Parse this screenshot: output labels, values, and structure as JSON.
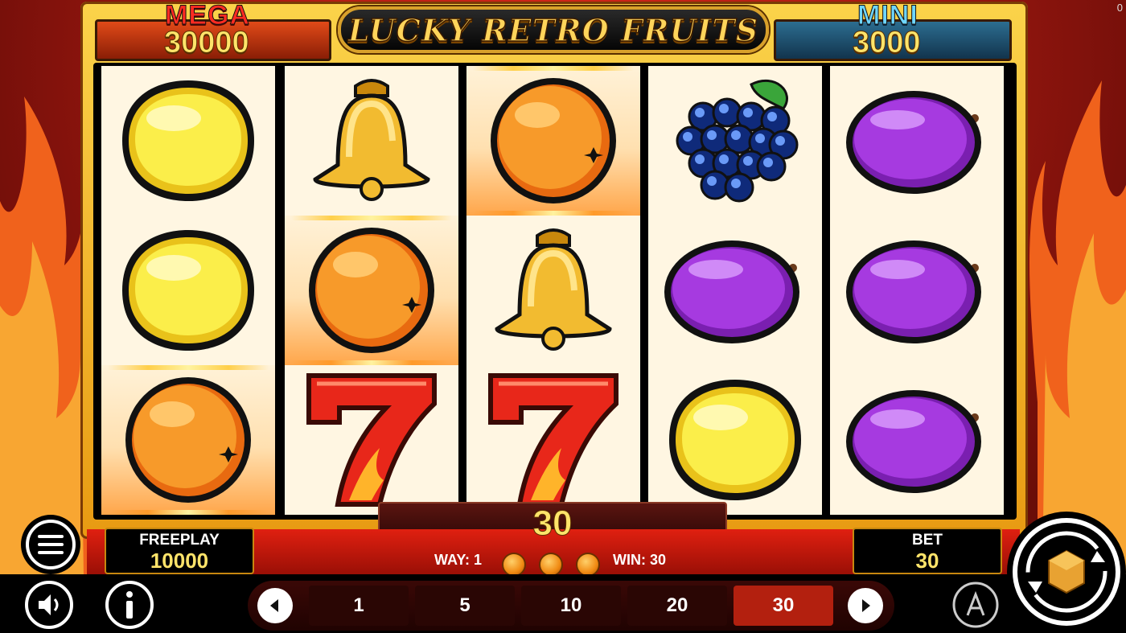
{
  "game": {
    "title": "LUCKY RETRO FRUITS",
    "corner_counter": "0"
  },
  "jackpots": {
    "mega": {
      "label": "MEGA",
      "value": "30000"
    },
    "mini": {
      "label": "MINI",
      "value": "3000"
    }
  },
  "reels": [
    [
      "lemon",
      "lemon",
      "orange"
    ],
    [
      "bell",
      "orange",
      "seven"
    ],
    [
      "orange",
      "bell",
      "seven"
    ],
    [
      "grapes",
      "plum",
      "lemon"
    ],
    [
      "plum",
      "plum",
      "plum"
    ]
  ],
  "winning_cells": [
    [
      0,
      2
    ],
    [
      1,
      1
    ],
    [
      2,
      0
    ]
  ],
  "win_display": {
    "value": "30"
  },
  "freeplay": {
    "label": "FREEPLAY",
    "value": "10000"
  },
  "bet": {
    "label": "BET",
    "value": "30"
  },
  "way_info": {
    "way_text": "WAY: 1",
    "win_text": "WIN: 30"
  },
  "bet_options": [
    "1",
    "5",
    "10",
    "20",
    "30"
  ],
  "selected_bet": "30",
  "icons": {
    "menu": "menu-icon",
    "sound": "sound-icon",
    "info": "info-icon",
    "autoplay": "autoplay-icon",
    "spin": "spin-icon",
    "prev": "left-arrow-icon",
    "next": "right-arrow-icon"
  },
  "colors": {
    "accent_gold": "#ffe46a",
    "selected_bet": "#b3200f",
    "frame": "#f2b22a"
  }
}
